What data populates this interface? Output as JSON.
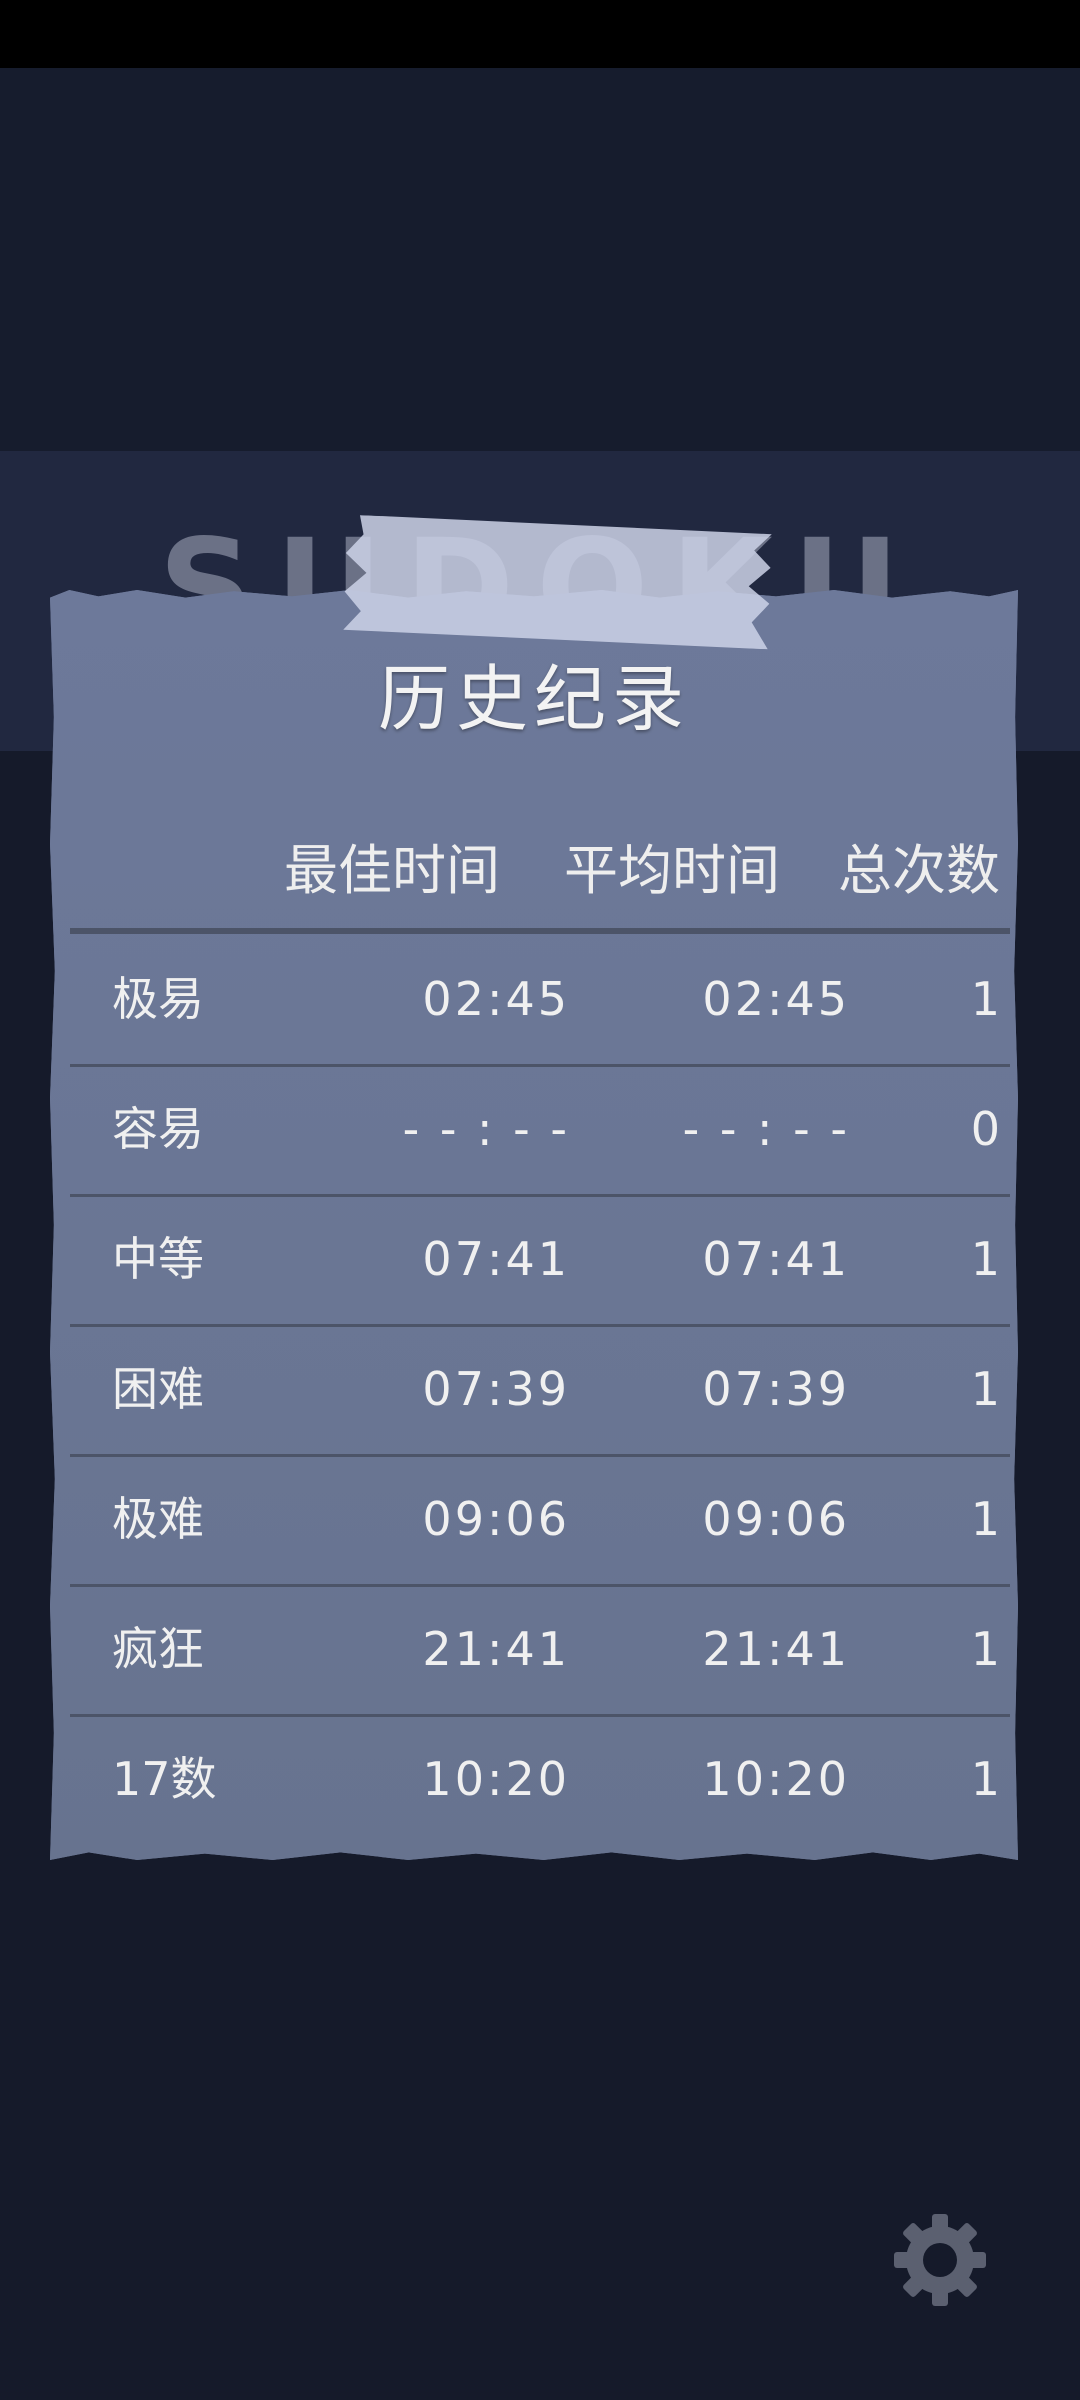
{
  "banner": {
    "title": "SUDOKU"
  },
  "history": {
    "title": "历史纪录",
    "headers": {
      "best": "最佳时间",
      "average": "平均时间",
      "total": "总次数"
    },
    "rows": [
      {
        "level": "极易",
        "best": "02:45",
        "avg": "02:45",
        "count": "1"
      },
      {
        "level": "容易",
        "best": "- - : - -",
        "avg": "- - : - -",
        "count": "0"
      },
      {
        "level": "中等",
        "best": "07:41",
        "avg": "07:41",
        "count": "1"
      },
      {
        "level": "困难",
        "best": "07:39",
        "avg": "07:39",
        "count": "1"
      },
      {
        "level": "极难",
        "best": "09:06",
        "avg": "09:06",
        "count": "1"
      },
      {
        "level": "疯狂",
        "best": "21:41",
        "avg": "21:41",
        "count": "1"
      },
      {
        "level": "17数",
        "best": "10:20",
        "avg": "10:20",
        "count": "1"
      }
    ]
  },
  "icons": {
    "settings": "gear-icon"
  },
  "colors": {
    "background": "#151a2a",
    "card": "#6a7697",
    "text": "#f0f0f0",
    "gear": "#5b6070"
  }
}
